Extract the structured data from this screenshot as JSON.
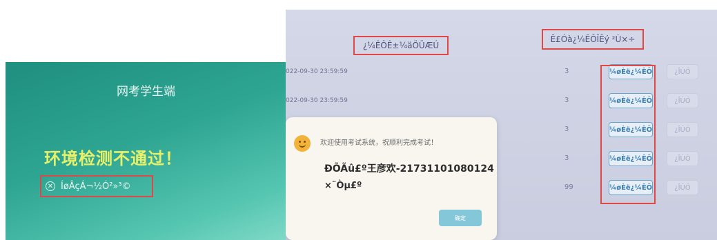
{
  "left": {
    "app_title": "网考学生端",
    "env_status": "环境检测不通过！",
    "error_icon": "circle-x-icon",
    "error_text": "ÍøÂçÁ¬½Ó²»³©"
  },
  "right": {
    "header_time": "¿¼ÊÔÊ±¼äÖÜÆÚ",
    "header_count": "Ê£Óà¿¼ÊÔÎÊý ²Ù×÷",
    "rows": [
      {
        "time": "022-09-30 23:59:59",
        "count": "3",
        "start": "¼øÈë¿¼ÊÔ",
        "other": "¿ÎÚÓ"
      },
      {
        "time": "022-09-30 23:59:59",
        "count": "3",
        "start": "¼øÈë¿¼ÊÔ",
        "other": "¿ÎÚÓ"
      },
      {
        "time": "",
        "count": "3",
        "start": "¼øÈë¿¼ÊÔ",
        "other": "¿ÎÚÓ"
      },
      {
        "time": "",
        "count": "3",
        "start": "¼øÈë¿¼ÊÔ",
        "other": "¿ÎÚÓ"
      },
      {
        "time": "",
        "count": "99",
        "start": "¼øÈë¿¼ÊÔ",
        "other": "¿ÎÚÓ"
      }
    ],
    "dialog": {
      "welcome": "欢迎使用考试系统，祝顺利完成考试！",
      "name_line": "ÐÕÃû£º王彦欢-21731101080124",
      "id_line": "×¨Òµ£º",
      "confirm_label": "确定"
    }
  }
}
